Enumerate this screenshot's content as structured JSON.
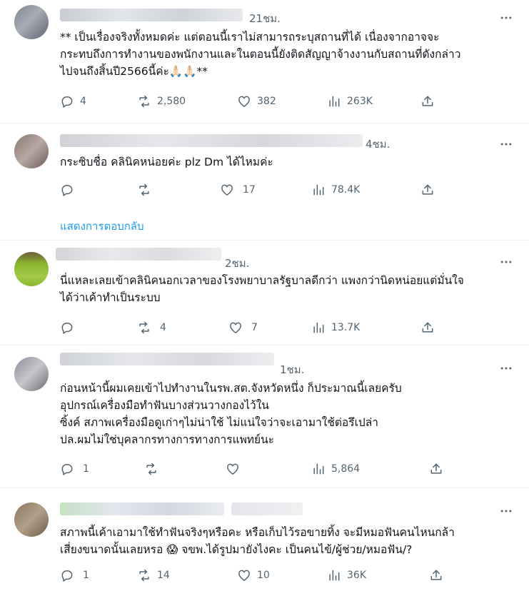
{
  "replies": [
    {
      "time": "21ชม.",
      "text": "** เป็นเรื่องจริงทั้งหมดค่ะ แต่ตอนนี้เราไม่สามารถระบุสถานที่ได้ เนื่องจากอาจจะ\nกระทบถึงการทำงานของพนักงานและในตอนนี้ยังติดสัญญาจ้างงานกับสถานที่ดังกล่าว\nไปจนถึงสิ้นปี2566นี้ค่ะ🙏🏻🙏🏻**",
      "replies_count": "4",
      "reposts_count": "2,580",
      "likes_count": "382",
      "views_count": "263K",
      "avatar_colors": [
        "#7e8590",
        "#a7acb4",
        "#5e6570"
      ]
    },
    {
      "time": "4ชม.",
      "text": "กระซิบชื่อ คลินิคหน่อยค่ะ plz Dm ได้ไหมค่ะ",
      "replies_count": "",
      "reposts_count": "",
      "likes_count": "17",
      "views_count": "78.4K",
      "avatar_colors": [
        "#8a7670",
        "#b8a9a3",
        "#6b5853"
      ]
    },
    {
      "time": "2ชม.",
      "text": "นี่แหละเลยเข้าคลินิคนอกเวลาของโรงพยาบาลรัฐบาลดีกว่า แพงกว่านิดหน่อยแต่มั่นใจ\nได้ว่าเค้าทำเป็นระบบ",
      "replies_count": "",
      "reposts_count": "4",
      "likes_count": "7",
      "views_count": "13.7K",
      "avatar_colors": [
        "#8ab82c",
        "#a3c94a",
        "#6e5a3d"
      ]
    },
    {
      "time": "1ชม.",
      "text": "ก่อนหน้านี้ผมเคยเข้าไปทำงานในรพ.สต.จังหวัดหนึ่ง ก็ประมาณนี้เลยครับ\nอุปกรณ์เครื่องมือทำฟันบางส่วนวางกองไว้ใน\nซิ้งค์ สภาพเครื่องมือดูเก่าๆไม่น่าใช้ ไม่แน่ใจว่าจะเอามาใช้ต่อรึเปล่า\nปล.ผมไม่ใช่บุคลากรทางการทางการแพทย์นะ",
      "replies_count": "1",
      "reposts_count": "",
      "likes_count": "",
      "views_count": "5,864",
      "avatar_colors": [
        "#8e8e98",
        "#c6c6cc",
        "#6a6a72"
      ]
    },
    {
      "time": "",
      "text": "สภาพนี้เค้าเอามาใช้ทำฟันจริงๆหรือคะ หรือเก็บไว้รอขายทิ้ง จะมีหมอฟันคนไหนกล้า\nเสี่ยงขนาดนั้นเลยหรอ 😱 จขพ.ได้รูปมายังไงคะ เป็นคนไข้/ผู้ช่วย/หมอฟัน/?",
      "replies_count": "1",
      "reposts_count": "14",
      "likes_count": "10",
      "views_count": "36K",
      "avatar_colors": [
        "#8a7560",
        "#b3a08a",
        "#6b5a48"
      ]
    }
  ],
  "show_replies_label": "แสดงการตอบกลับ",
  "icons": {
    "reply": "reply-icon",
    "repost": "repost-icon",
    "like": "like-icon",
    "views": "views-icon",
    "share": "share-icon",
    "more": "more-icon"
  },
  "colors": {
    "text": "#0f1419",
    "secondary": "#536471",
    "link": "#1d9bf0",
    "divider": "#eff3f4"
  }
}
